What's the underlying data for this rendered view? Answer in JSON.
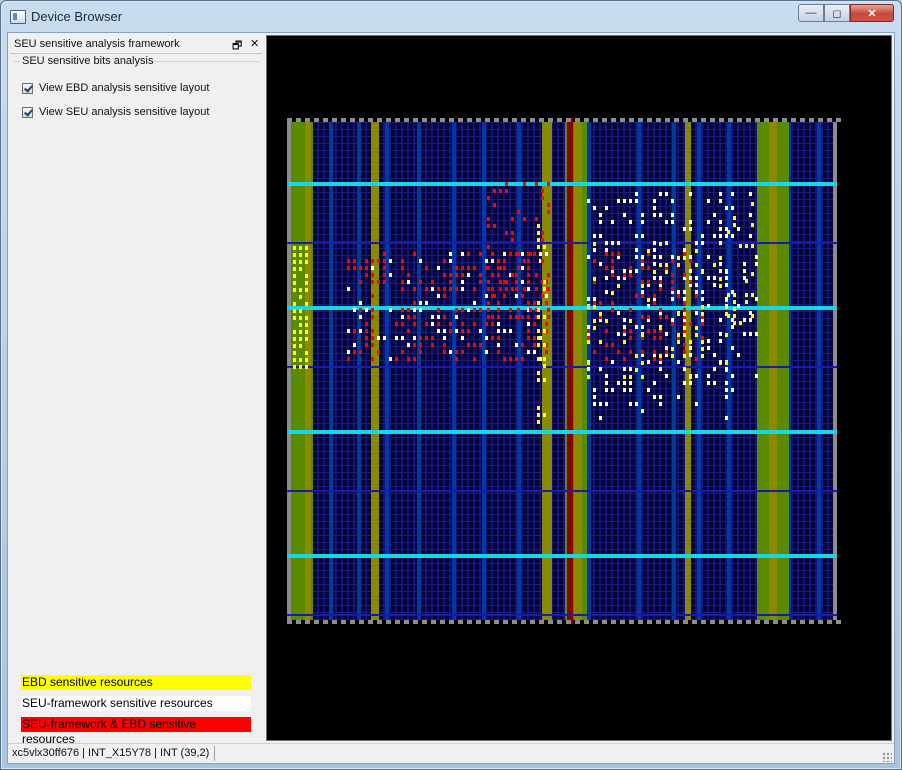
{
  "window": {
    "title": "Device Browser",
    "caption_buttons": {
      "minimize": "—",
      "restore": "◻",
      "close": "✕"
    }
  },
  "panel": {
    "title": "SEU sensitive analysis framework",
    "float_icon": "float-icon",
    "close_icon": "close-icon",
    "group_label": "SEU sensitive bits analysis",
    "checkboxes": [
      {
        "label": "View EBD analysis sensitive layout",
        "checked": true
      },
      {
        "label": "View SEU analysis sensitive layout",
        "checked": true
      }
    ],
    "legend": [
      {
        "label": "EBD sensitive resources",
        "bg": "#ffff00",
        "fg": "#000000"
      },
      {
        "label": "SEU-framework sensitive resources",
        "bg": "#ffffff",
        "fg": "#000000"
      },
      {
        "label": "SEU-framework & EBD sensitive resources",
        "bg": "#ff0000",
        "fg": "#000000"
      }
    ]
  },
  "status": {
    "text": "xc5vlx30ff676 | INT_X15Y78 | INT (39,2)"
  },
  "colors": {
    "background": "#000000",
    "interconnect": "#10108a",
    "routing": "#2a2aa8",
    "clb": "#003a9c",
    "bram": "#5a8a00",
    "dsp": "#8a8a00",
    "hclk_row": "#19d6e6",
    "io_column": "#8c8c8c",
    "center": "#8a0000",
    "ebd": "#ffff00",
    "seu": "#ffffff",
    "both": "#ff0000"
  }
}
